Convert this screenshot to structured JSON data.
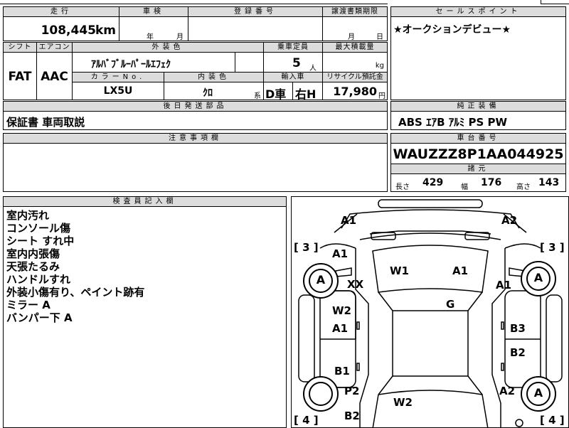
{
  "top": {
    "mileage_label": "走行",
    "mileage_value": "108,445",
    "mileage_unit": "km",
    "inspection_label": "車検",
    "inspection_year_unit": "年",
    "inspection_month_unit": "月",
    "registration_label": "登録番号",
    "transfer_label": "譲渡書類期限",
    "transfer_month_unit": "月",
    "transfer_day_unit": "日"
  },
  "sales_point": {
    "label": "セールスポイント",
    "text": "★オークションデビュー★"
  },
  "spec": {
    "shift_label": "シフト",
    "shift_value": "FAT",
    "ac_label": "エアコン",
    "ac_value": "AAC",
    "exterior_label": "外装色",
    "exterior_value": "ｱﾙﾊﾞﾌﾞﾙｰﾊﾟｰﾙｴﾌｪｸ",
    "capacity_label": "乗車定員",
    "capacity_value": "5",
    "capacity_unit": "人",
    "max_load_label": "最大積載量",
    "max_load_unit": "kg",
    "color_no_label": "カラーNo.",
    "color_no_value": "LX5U",
    "interior_label": "内装色",
    "interior_value": "ｸﾛ",
    "interior_suffix": "系",
    "import_label": "輸入車",
    "import_value": "D車",
    "steering_value": "右H",
    "recycle_label": "リサイクル預託金",
    "recycle_value": "17,980",
    "recycle_unit": "円"
  },
  "parts": {
    "label": "後日発送部品",
    "text": "保証書 車両取説"
  },
  "equipment": {
    "label": "純正装備",
    "text": "ABS ｴｱB ｱﾙﾐ PS PW"
  },
  "notes": {
    "label": "注意事項欄",
    "text": ""
  },
  "chassis": {
    "label": "車台番号",
    "value": "WAUZZZ8P1AA044925"
  },
  "dimensions": {
    "label": "諸元",
    "length_label": "長さ",
    "length_value": "429",
    "width_label": "幅",
    "width_value": "176",
    "height_label": "高さ",
    "height_value": "143"
  },
  "inspector": {
    "label": "検査員記入欄",
    "lines": [
      "室内汚れ",
      "コンソール傷",
      "シート すれ中",
      "室内内張傷",
      "天張たるみ",
      "ハンドルすれ",
      "外装小傷有り、ペイント跡有",
      "ミラー A",
      "バンパー下 A"
    ]
  },
  "diagram": {
    "tire_front_left": "3",
    "tire_front_right": "3",
    "tire_rear_left": "4",
    "tire_rear_right": "4",
    "wheel_fl": "A",
    "wheel_fr": "A",
    "wheel_rr": "A",
    "marks": {
      "front_bumper_left": "A1",
      "front_bumper_right": "A2",
      "fender_left": "A1",
      "fender_left2": "XX",
      "windshield": "W1",
      "hood_right": "A1",
      "fender_right": "A1",
      "roof": "G",
      "front_door_left_w": "W2",
      "front_door_left": "A1",
      "front_door_right": "B3",
      "rear_door_left": "B1",
      "rear_door_right": "B2",
      "quarter_left": "P2",
      "quarter_right": "A2",
      "rear_window": "W2",
      "rear_bumper_left": "B2"
    }
  }
}
